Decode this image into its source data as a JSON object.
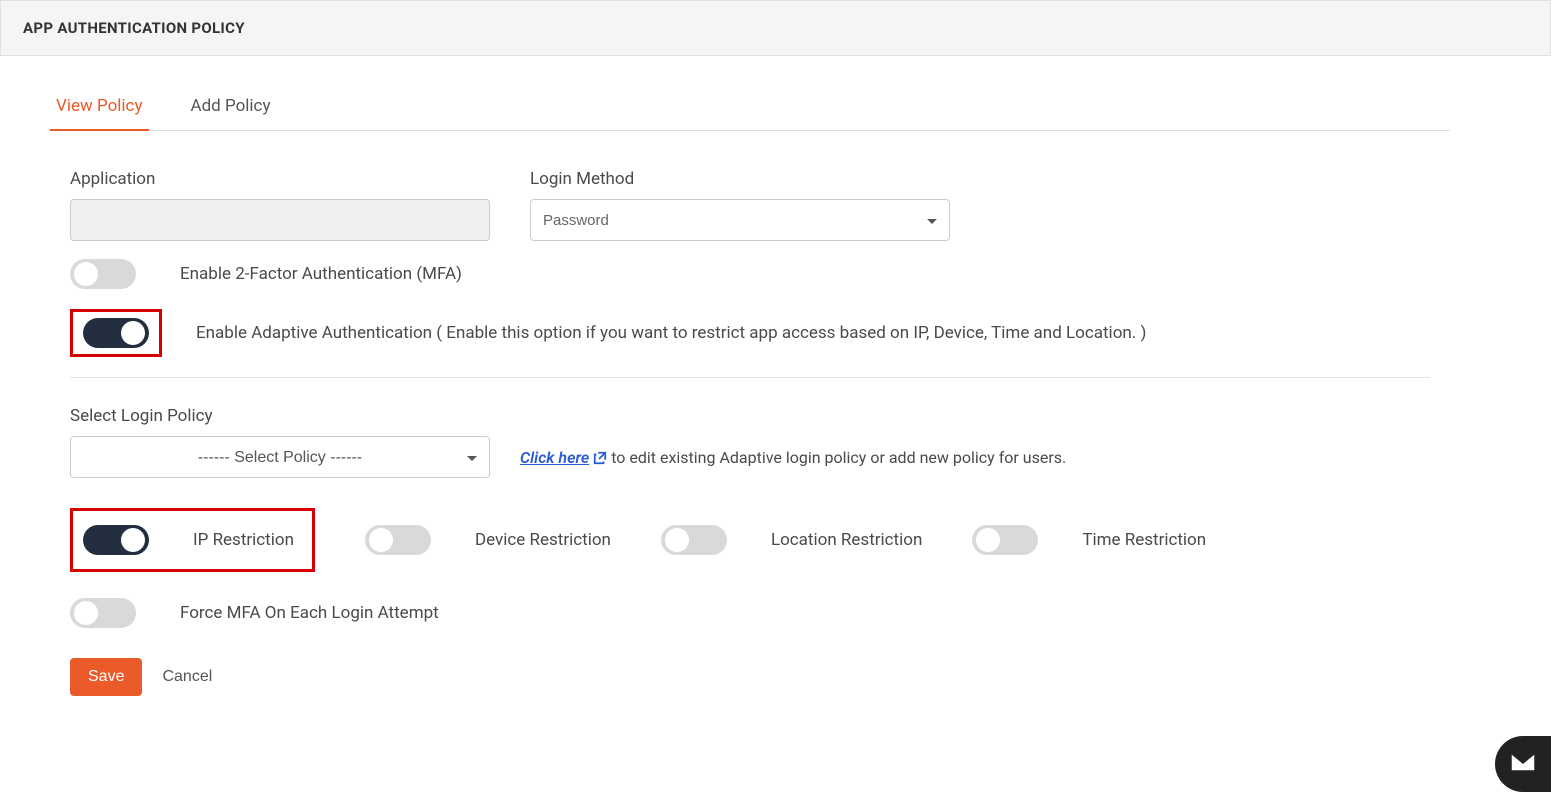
{
  "header": {
    "title": "APP AUTHENTICATION POLICY"
  },
  "tabs": {
    "view": "View Policy",
    "add": "Add Policy"
  },
  "form": {
    "application_label": "Application",
    "application_value": "",
    "login_method_label": "Login Method",
    "login_method_value": "Password",
    "mfa_label": "Enable 2-Factor Authentication (MFA)",
    "adaptive_label": "Enable Adaptive Authentication ( Enable this option if you want to restrict app access based on IP, Device, Time and Location. )",
    "select_policy_label": "Select Login Policy",
    "select_policy_value": "------ Select Policy ------",
    "click_here": "Click here",
    "hint_rest": " to edit existing Adaptive login policy or add new policy for users.",
    "ip_restriction": "IP Restriction",
    "device_restriction": "Device Restriction",
    "location_restriction": "Location Restriction",
    "time_restriction": "Time Restriction",
    "force_mfa": "Force MFA On Each Login Attempt",
    "save": "Save",
    "cancel": "Cancel"
  }
}
